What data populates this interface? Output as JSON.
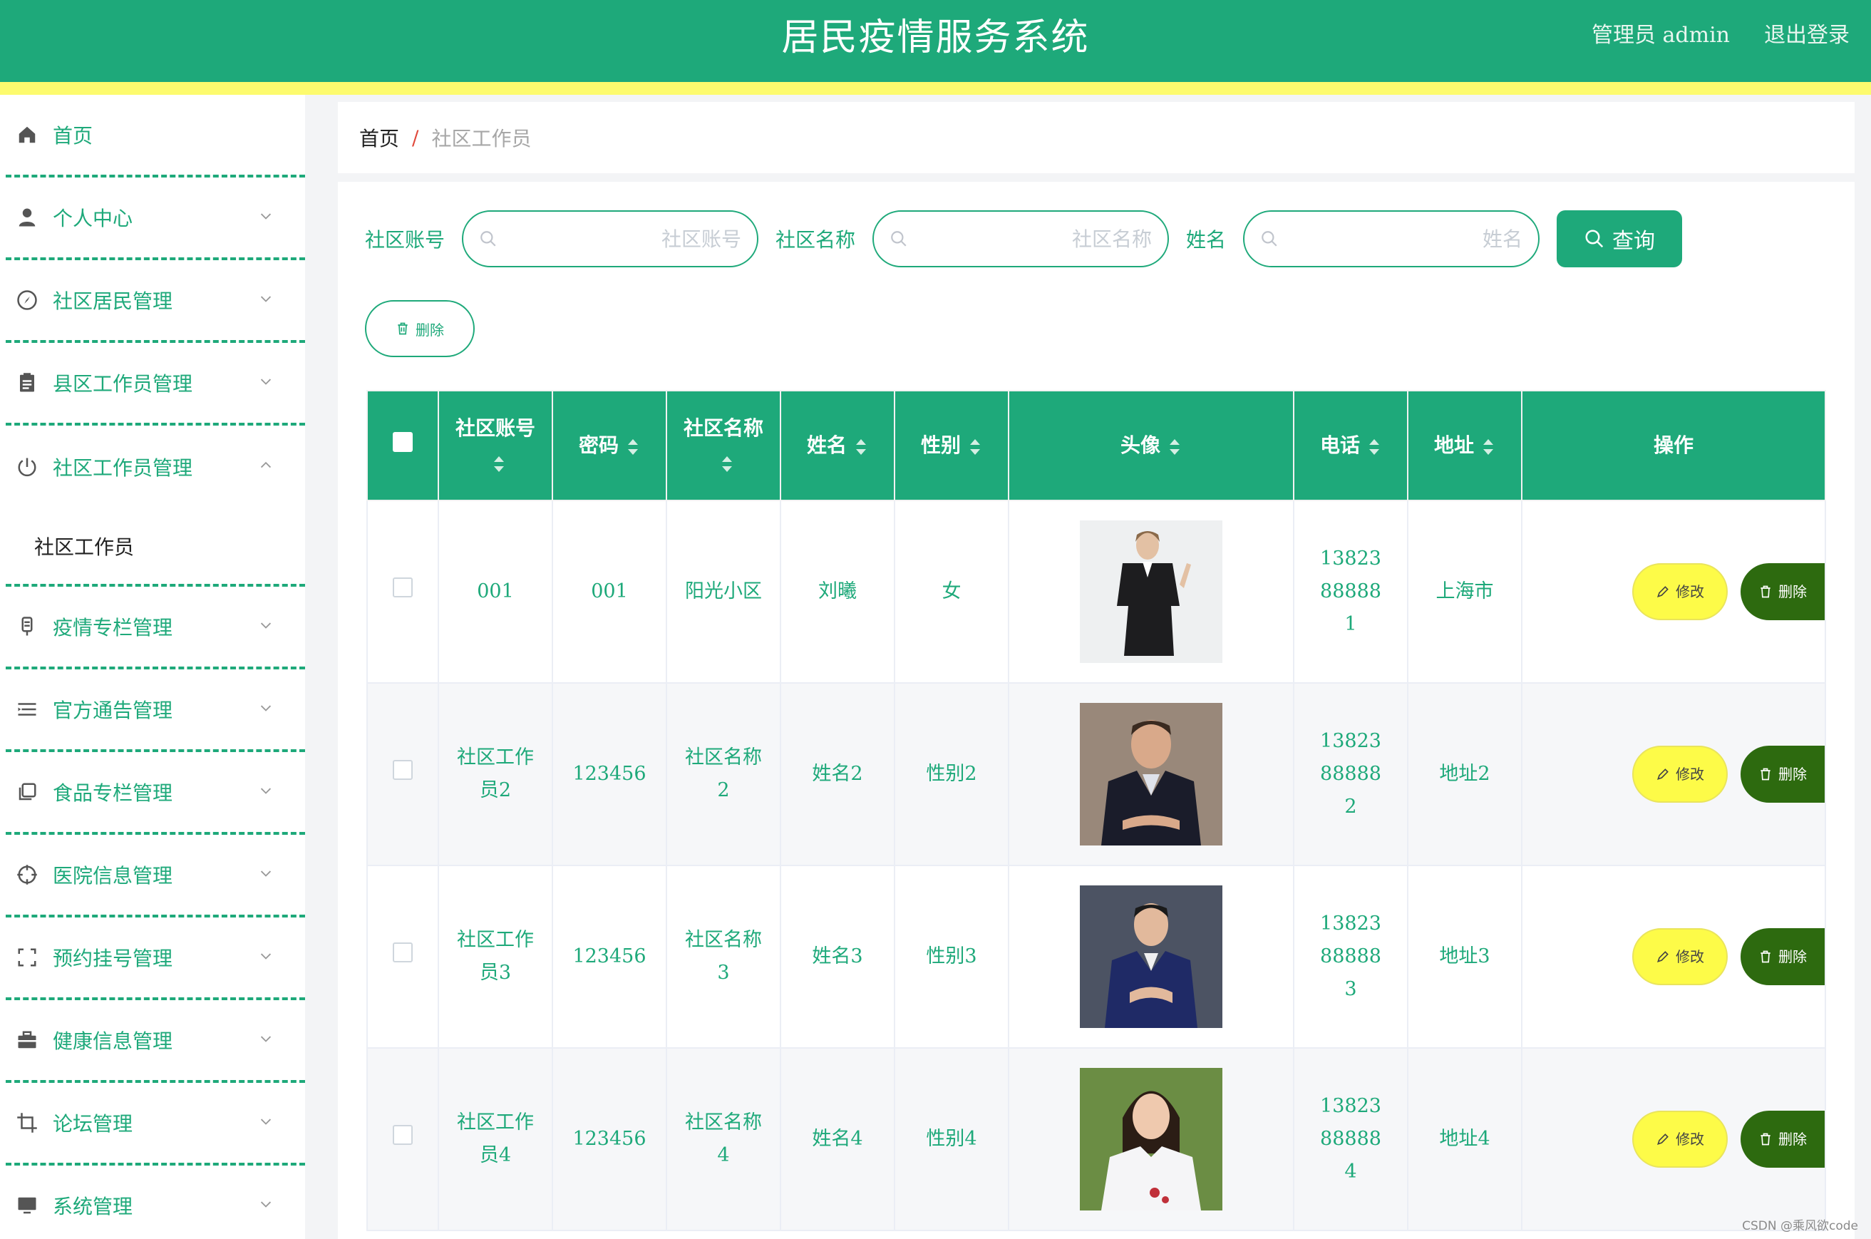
{
  "header": {
    "title": "居民疫情服务系统",
    "user_label": "管理员 admin",
    "logout_label": "退出登录"
  },
  "sidebar": {
    "items": [
      {
        "label": "首页",
        "icon": "home-icon",
        "expandable": false
      },
      {
        "label": "个人中心",
        "icon": "user-icon",
        "expandable": true
      },
      {
        "label": "社区居民管理",
        "icon": "compass-icon",
        "expandable": true
      },
      {
        "label": "县区工作员管理",
        "icon": "clipboard-icon",
        "expandable": true
      },
      {
        "label": "社区工作员管理",
        "icon": "power-icon",
        "expandable": true,
        "expanded": true,
        "children": [
          "社区工作员"
        ]
      },
      {
        "label": "疫情专栏管理",
        "icon": "mic-icon",
        "expandable": true
      },
      {
        "label": "官方通告管理",
        "icon": "list-icon",
        "expandable": true
      },
      {
        "label": "食品专栏管理",
        "icon": "copy-icon",
        "expandable": true
      },
      {
        "label": "医院信息管理",
        "icon": "crosshair-icon",
        "expandable": true
      },
      {
        "label": "预约挂号管理",
        "icon": "frame-icon",
        "expandable": true
      },
      {
        "label": "健康信息管理",
        "icon": "briefcase-icon",
        "expandable": true
      },
      {
        "label": "论坛管理",
        "icon": "crop-icon",
        "expandable": true
      },
      {
        "label": "系统管理",
        "icon": "monitor-icon",
        "expandable": true
      }
    ]
  },
  "breadcrumb": {
    "home": "首页",
    "separator": "/",
    "current": "社区工作员"
  },
  "search": {
    "account_label": "社区账号",
    "account_placeholder": "社区账号",
    "community_label": "社区名称",
    "community_placeholder": "社区名称",
    "name_label": "姓名",
    "name_placeholder": "姓名",
    "query_label": "查询"
  },
  "batch_delete_label": "删除",
  "table": {
    "columns": [
      "社区账号",
      "密码",
      "社区名称",
      "姓名",
      "性别",
      "头像",
      "电话",
      "地址",
      "操作"
    ],
    "edit_label": "修改",
    "delete_label": "删除",
    "rows": [
      {
        "account": "001",
        "password": "001",
        "community": "阳光小区",
        "name": "刘曦",
        "gender": "女",
        "phone": "13823888881",
        "address": "上海市"
      },
      {
        "account": "社区工作员2",
        "password": "123456",
        "community": "社区名称2",
        "name": "姓名2",
        "gender": "性别2",
        "phone": "13823888882",
        "address": "地址2"
      },
      {
        "account": "社区工作员3",
        "password": "123456",
        "community": "社区名称3",
        "name": "姓名3",
        "gender": "性别3",
        "phone": "13823888883",
        "address": "地址3"
      },
      {
        "account": "社区工作员4",
        "password": "123456",
        "community": "社区名称4",
        "name": "姓名4",
        "gender": "性别4",
        "phone": "13823888884",
        "address": "地址4"
      }
    ]
  },
  "watermark": "CSDN @乘风欲code",
  "colors": {
    "primary": "#1ea97a",
    "stripe": "#fdfb6e",
    "edit_button": "#fdfb48",
    "delete_button": "#2d6a0f"
  }
}
